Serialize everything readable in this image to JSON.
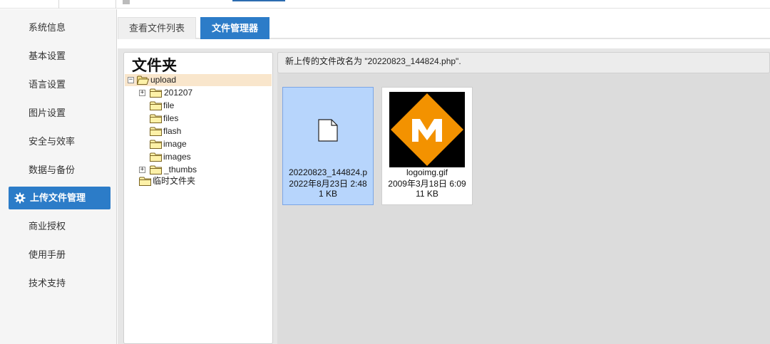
{
  "sidebar": {
    "items": [
      {
        "label": "系统信息"
      },
      {
        "label": "基本设置"
      },
      {
        "label": "语言设置"
      },
      {
        "label": "图片设置"
      },
      {
        "label": "安全与效率"
      },
      {
        "label": "数据与备份"
      },
      {
        "label": "上传文件管理",
        "icon": "gear-icon",
        "active": true
      },
      {
        "label": "商业授权"
      },
      {
        "label": "使用手册"
      },
      {
        "label": "技术支持"
      }
    ]
  },
  "tabs": [
    {
      "label": "查看文件列表"
    },
    {
      "label": "文件管理器",
      "active": true
    }
  ],
  "tree": {
    "title": "文件夹",
    "nodes": [
      {
        "label": "upload",
        "expander": "−",
        "icon": "folder-open-icon"
      },
      {
        "label": "201207",
        "expander": "+",
        "icon": "folder-icon"
      },
      {
        "label": "file",
        "icon": "folder-icon"
      },
      {
        "label": "files",
        "icon": "folder-icon"
      },
      {
        "label": "flash",
        "icon": "folder-icon"
      },
      {
        "label": "image",
        "icon": "folder-icon"
      },
      {
        "label": "images",
        "icon": "folder-icon"
      },
      {
        "label": "_thumbs",
        "expander": "+",
        "icon": "folder-icon"
      },
      {
        "label": "临时文件夹",
        "icon": "folder-icon"
      }
    ]
  },
  "message": "新上传的文件改名为 \"20220823_144824.php\".",
  "files": [
    {
      "name": "20220823_144824.p",
      "date": "2022年8月23日 2:48",
      "size": "1 KB",
      "icon": "blank-file-icon",
      "selected": true
    },
    {
      "name": "logoimg.gif",
      "date": "2009年3月18日 6:09",
      "size": "11 KB",
      "icon": "m-logo-image"
    }
  ],
  "colors": {
    "accent": "#2c7cc8",
    "selection": "#b7d5fc",
    "tree_highlight": "#f9e6cc",
    "logo_orange": "#f39200"
  }
}
